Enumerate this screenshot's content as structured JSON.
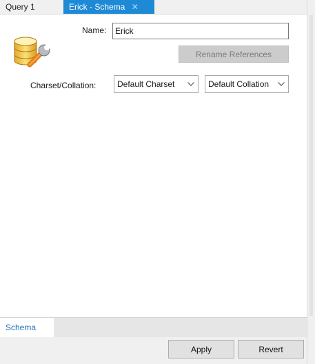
{
  "tabs": [
    {
      "label": "Query 1"
    },
    {
      "label": "Erick - Schema",
      "close_glyph": "✕"
    }
  ],
  "form": {
    "name_label": "Name:",
    "name_value": "Erick",
    "rename_button": "Rename References",
    "charset_label": "Charset/Collation:",
    "charset_select": "Default Charset",
    "collation_select": "Default Collation"
  },
  "subtabs": [
    {
      "label": "Schema"
    }
  ],
  "buttons": {
    "apply": "Apply",
    "revert": "Revert"
  },
  "icons": {
    "schema": "database-wrench-icon",
    "dropdown": "chevron-down-icon"
  },
  "colors": {
    "accent": "#1e8ad6",
    "subtab_text": "#1e6fb5",
    "disabled_button": "#cccccc"
  }
}
